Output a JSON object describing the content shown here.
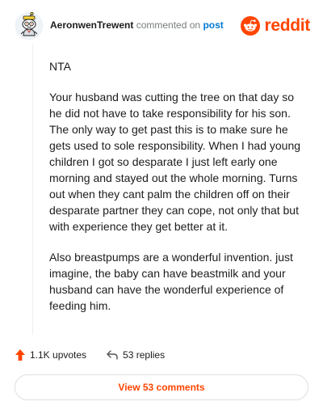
{
  "header": {
    "username": "AeronwenTrewent",
    "action": "commented on",
    "post_link": "post",
    "brand_name": "reddit"
  },
  "comment": {
    "paragraphs": [
      "NTA",
      "Your husband was cutting the tree on that day so he did not have to take responsibility for his son. The only way to get past this is to make sure he gets used to sole responsibility. When I had young children I got so desparate I just left early one morning and stayed out the whole morning. Turns out when they cant palm the children off on their desparate partner they can cope, not only that but with experience they get better at it.",
      "Also breastpumps are a wonderful invention. just imagine, the baby can have beastmilk and your husband can have the wonderful experience of feeding him."
    ]
  },
  "footer": {
    "upvotes": "1.1K upvotes",
    "replies": "53 replies",
    "view_comments": "View 53 comments"
  },
  "colors": {
    "brand": "#ff4500",
    "link": "#0079d3",
    "text": "#1c1c1c",
    "muted": "#787c7e"
  },
  "icons": {
    "avatar": "snoo-avatar-icon",
    "logo": "reddit-logo-icon",
    "upvote": "upvote-arrow-icon",
    "reply": "reply-arrow-icon"
  }
}
